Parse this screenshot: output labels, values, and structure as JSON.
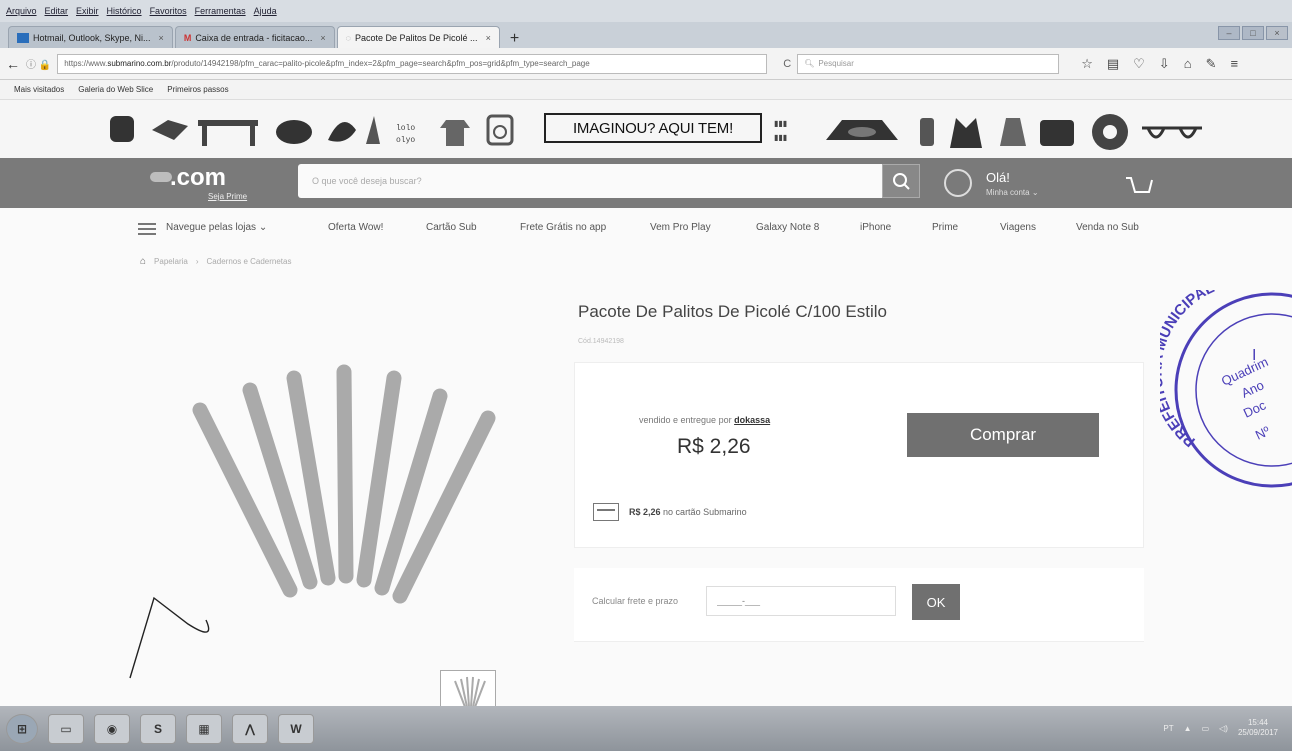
{
  "menubar": [
    "Arquivo",
    "Editar",
    "Exibir",
    "Histórico",
    "Favoritos",
    "Ferramentas",
    "Ajuda"
  ],
  "tabs": [
    {
      "label": "Hotmail, Outlook, Skype, Ni..."
    },
    {
      "label": "Caixa de entrada - ficitacao..."
    },
    {
      "label": "Pacote De Palitos De Picolé ..."
    }
  ],
  "browser": {
    "url_prefix": "https://www.",
    "url_domain": "submarino.com.br",
    "url_rest": "/produto/14942198/pfm_carac=palito-picole&pfm_index=2&pfm_page=search&pfm_pos=grid&pfm_type=search_page",
    "search_placeholder": "Pesquisar"
  },
  "bookmarks": [
    "Mais visitados",
    "Galeria do Web Slice",
    "Primeiros passos"
  ],
  "banner": {
    "text": "IMAGINOU? AQUI TEM!"
  },
  "header": {
    "logo": ".com",
    "logo_sub": "Seja Prime",
    "search_placeholder": "O que você deseja buscar?",
    "greeting": "Olá!",
    "account": "Minha conta"
  },
  "nav": {
    "menu_label": "Navegue pelas lojas",
    "items": [
      "Oferta Wow!",
      "Cartão Sub",
      "Frete Grátis no app",
      "Vem Pro Play",
      "Galaxy Note 8",
      "iPhone",
      "Prime",
      "Viagens",
      "Venda no Sub"
    ]
  },
  "breadcrumb": [
    "Papelaria",
    "Cadernos e Cadernetas"
  ],
  "product": {
    "title": "Pacote De Palitos De Picolé C/100 Estilo",
    "sku": "Cód.14942198",
    "seller_prefix": "vendido e entregue por",
    "seller": "dokassa",
    "price": "R$ 2,26",
    "buy_label": "Comprar",
    "card_price": "R$ 2,26",
    "card_text": "no cartão Submarino"
  },
  "shipping": {
    "label": "Calcular frete e prazo",
    "placeholder": "_____-___",
    "ok_label": "OK"
  },
  "stamp": {
    "lines": [
      "PREFEITURA MUNICIPAL",
      "I",
      "Quadrim",
      "Ano",
      "Doc",
      "Nº"
    ]
  },
  "taskbar": {
    "items": [
      "S",
      "W"
    ],
    "lang": "PT",
    "time": "15:44",
    "date": "25/09/2017"
  }
}
